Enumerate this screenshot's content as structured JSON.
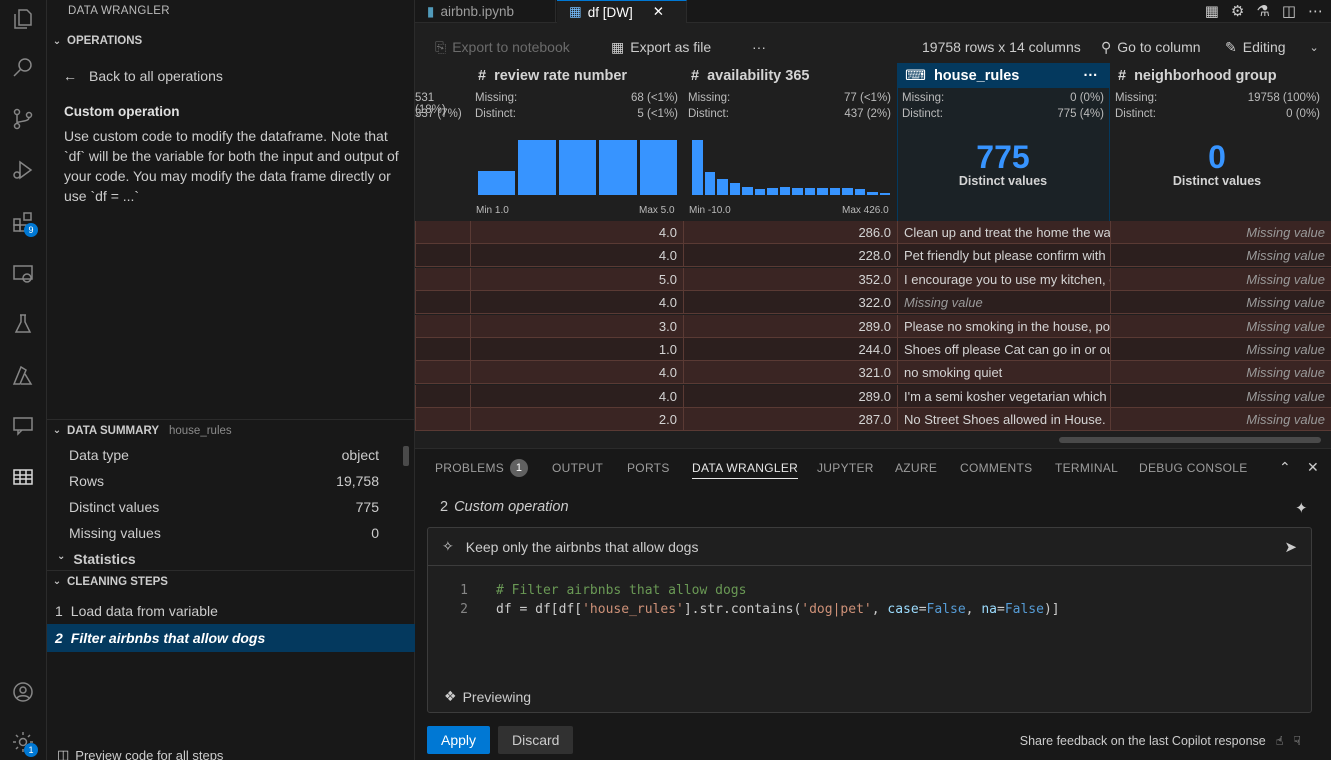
{
  "activity_bar": {
    "items": [
      "explorer-icon",
      "search-icon",
      "source-control-icon",
      "run-debug-icon",
      "extensions-icon",
      "remote-explorer-icon",
      "testing-icon",
      "azure-icon",
      "comments-icon",
      "data-wrangler-icon"
    ],
    "extensions_badge": "9",
    "settings_badge": "1"
  },
  "sidebar": {
    "title": "DATA WRANGLER",
    "operations_header": "OPERATIONS",
    "back_label": "Back to all operations",
    "operation_title": "Custom operation",
    "operation_desc": "Use custom code to modify the dataframe. Note that `df` will be the variable for both the input and output of your code. You may modify the data frame directly or use `df = ...`",
    "data_summary_header": "DATA SUMMARY",
    "data_summary_column": "house_rules",
    "summary": [
      {
        "label": "Data type",
        "value": "object"
      },
      {
        "label": "Rows",
        "value": "19,758"
      },
      {
        "label": "Distinct values",
        "value": "775"
      },
      {
        "label": "Missing values",
        "value": "0"
      }
    ],
    "statistics_label": "Statistics",
    "cleaning_steps_header": "CLEANING STEPS",
    "steps": [
      {
        "num": "1",
        "label": "Load data from variable"
      },
      {
        "num": "2",
        "label": "Filter airbnbs that allow dogs"
      }
    ],
    "preview_all_label": "Preview code for all steps"
  },
  "tabs": [
    {
      "label": "airbnb.ipynb"
    },
    {
      "label": "df [DW]"
    }
  ],
  "toolbar": {
    "export_notebook": "Export to notebook",
    "export_file": "Export as file",
    "more": "···",
    "shape": "19758 rows x 14 columns",
    "go_to_column": "Go to column",
    "editing": "Editing"
  },
  "grid": {
    "partial_col": {
      "missing": "531 (18%)",
      "distinct": "337 (7%)"
    },
    "columns": [
      {
        "name": "review rate number",
        "type_icon": "#",
        "missing_label": "Missing:",
        "missing": "68 (<1%)",
        "distinct_label": "Distinct:",
        "distinct": "5 (<1%)",
        "min": "Min 1.0",
        "max": "Max 5.0",
        "hist": [
          0.42,
          0.95,
          0.95,
          0.95,
          0.95
        ]
      },
      {
        "name": "availability 365",
        "type_icon": "#",
        "missing_label": "Missing:",
        "missing": "77 (<1%)",
        "distinct_label": "Distinct:",
        "distinct": "437 (2%)",
        "min": "Min -10.0",
        "max": "Max 426.0",
        "hist": [
          0.95,
          0.4,
          0.28,
          0.2,
          0.14,
          0.1,
          0.12,
          0.14,
          0.12,
          0.12,
          0.12,
          0.12,
          0.12,
          0.1,
          0.06,
          0.04
        ]
      },
      {
        "name": "house_rules",
        "type_icon": "text-column-icon",
        "missing_label": "Missing:",
        "missing": "0 (0%)",
        "distinct_label": "Distinct:",
        "distinct": "775 (4%)",
        "big": "775",
        "big_label": "Distinct values",
        "more": "···"
      },
      {
        "name": "neighborhood group",
        "type_icon": "#",
        "missing_label": "Missing:",
        "missing": "19758 (100%)",
        "distinct_label": "Distinct:",
        "distinct": "0 (0%)",
        "big": "0",
        "big_label": "Distinct values"
      }
    ],
    "missing_text": "Missing value",
    "rows": [
      {
        "rating": "4.0",
        "avail": "286.0",
        "rules": "Clean up and treat the home the way",
        "rules_missing": false
      },
      {
        "rating": "4.0",
        "avail": "228.0",
        "rules": "Pet friendly but please confirm with m",
        "rules_missing": false
      },
      {
        "rating": "5.0",
        "avail": "352.0",
        "rules": "I encourage you to use my kitchen, c",
        "rules_missing": false
      },
      {
        "rating": "4.0",
        "avail": "322.0",
        "rules": "Missing value",
        "rules_missing": true
      },
      {
        "rating": "3.0",
        "avail": "289.0",
        "rules": "Please no smoking in the house, por",
        "rules_missing": false
      },
      {
        "rating": "1.0",
        "avail": "244.0",
        "rules": "Shoes off please Cat can go in or out",
        "rules_missing": false
      },
      {
        "rating": "4.0",
        "avail": "321.0",
        "rules": "no smoking quiet",
        "rules_missing": false
      },
      {
        "rating": "4.0",
        "avail": "289.0",
        "rules": "I'm a semi kosher vegetarian which m",
        "rules_missing": false
      },
      {
        "rating": "2.0",
        "avail": "287.0",
        "rules": "No Street Shoes allowed in House. N",
        "rules_missing": false
      }
    ]
  },
  "panel": {
    "tabs": [
      {
        "label": "PROBLEMS",
        "badge": "1"
      },
      {
        "label": "OUTPUT"
      },
      {
        "label": "PORTS"
      },
      {
        "label": "DATA WRANGLER"
      },
      {
        "label": "JUPYTER"
      },
      {
        "label": "AZURE"
      },
      {
        "label": "COMMENTS"
      },
      {
        "label": "TERMINAL"
      },
      {
        "label": "DEBUG CONSOLE"
      }
    ],
    "step_number": "2",
    "step_name": "Custom operation",
    "prompt": "Keep only the airbnbs that allow dogs",
    "code": {
      "line1_num": "1",
      "line1": "# Filter airbnbs that allow dogs",
      "line2_num": "2",
      "t_df": "df",
      "t_eq": " = ",
      "t_df2": "df",
      "t_b1": "[",
      "t_df3": "df",
      "t_b2": "[",
      "t_col": "'house_rules'",
      "t_b3": "].str.",
      "t_fn": "contains",
      "t_p1": "(",
      "t_pat": "'dog|pet'",
      "t_c1": ", ",
      "t_case": "case",
      "t_e1": "=",
      "t_false1": "False",
      "t_c2": ", ",
      "t_na": "na",
      "t_e2": "=",
      "t_false2": "False",
      "t_end": ")]"
    },
    "previewing": "Previewing",
    "apply": "Apply",
    "discard": "Discard",
    "feedback": "Share feedback on the last Copilot response"
  }
}
